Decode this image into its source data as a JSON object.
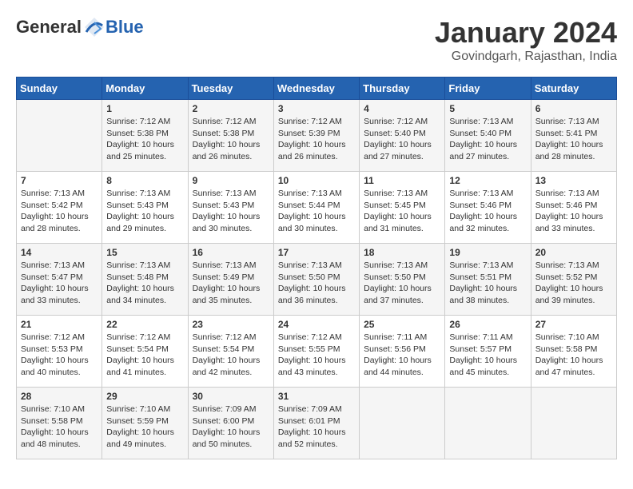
{
  "logo": {
    "general": "General",
    "blue": "Blue"
  },
  "title": "January 2024",
  "subtitle": "Govindgarh, Rajasthan, India",
  "days_of_week": [
    "Sunday",
    "Monday",
    "Tuesday",
    "Wednesday",
    "Thursday",
    "Friday",
    "Saturday"
  ],
  "weeks": [
    [
      {
        "day": "",
        "content": ""
      },
      {
        "day": "1",
        "content": "Sunrise: 7:12 AM\nSunset: 5:38 PM\nDaylight: 10 hours\nand 25 minutes."
      },
      {
        "day": "2",
        "content": "Sunrise: 7:12 AM\nSunset: 5:38 PM\nDaylight: 10 hours\nand 26 minutes."
      },
      {
        "day": "3",
        "content": "Sunrise: 7:12 AM\nSunset: 5:39 PM\nDaylight: 10 hours\nand 26 minutes."
      },
      {
        "day": "4",
        "content": "Sunrise: 7:12 AM\nSunset: 5:40 PM\nDaylight: 10 hours\nand 27 minutes."
      },
      {
        "day": "5",
        "content": "Sunrise: 7:13 AM\nSunset: 5:40 PM\nDaylight: 10 hours\nand 27 minutes."
      },
      {
        "day": "6",
        "content": "Sunrise: 7:13 AM\nSunset: 5:41 PM\nDaylight: 10 hours\nand 28 minutes."
      }
    ],
    [
      {
        "day": "7",
        "content": "Sunrise: 7:13 AM\nSunset: 5:42 PM\nDaylight: 10 hours\nand 28 minutes."
      },
      {
        "day": "8",
        "content": "Sunrise: 7:13 AM\nSunset: 5:43 PM\nDaylight: 10 hours\nand 29 minutes."
      },
      {
        "day": "9",
        "content": "Sunrise: 7:13 AM\nSunset: 5:43 PM\nDaylight: 10 hours\nand 30 minutes."
      },
      {
        "day": "10",
        "content": "Sunrise: 7:13 AM\nSunset: 5:44 PM\nDaylight: 10 hours\nand 30 minutes."
      },
      {
        "day": "11",
        "content": "Sunrise: 7:13 AM\nSunset: 5:45 PM\nDaylight: 10 hours\nand 31 minutes."
      },
      {
        "day": "12",
        "content": "Sunrise: 7:13 AM\nSunset: 5:46 PM\nDaylight: 10 hours\nand 32 minutes."
      },
      {
        "day": "13",
        "content": "Sunrise: 7:13 AM\nSunset: 5:46 PM\nDaylight: 10 hours\nand 33 minutes."
      }
    ],
    [
      {
        "day": "14",
        "content": "Sunrise: 7:13 AM\nSunset: 5:47 PM\nDaylight: 10 hours\nand 33 minutes."
      },
      {
        "day": "15",
        "content": "Sunrise: 7:13 AM\nSunset: 5:48 PM\nDaylight: 10 hours\nand 34 minutes."
      },
      {
        "day": "16",
        "content": "Sunrise: 7:13 AM\nSunset: 5:49 PM\nDaylight: 10 hours\nand 35 minutes."
      },
      {
        "day": "17",
        "content": "Sunrise: 7:13 AM\nSunset: 5:50 PM\nDaylight: 10 hours\nand 36 minutes."
      },
      {
        "day": "18",
        "content": "Sunrise: 7:13 AM\nSunset: 5:50 PM\nDaylight: 10 hours\nand 37 minutes."
      },
      {
        "day": "19",
        "content": "Sunrise: 7:13 AM\nSunset: 5:51 PM\nDaylight: 10 hours\nand 38 minutes."
      },
      {
        "day": "20",
        "content": "Sunrise: 7:13 AM\nSunset: 5:52 PM\nDaylight: 10 hours\nand 39 minutes."
      }
    ],
    [
      {
        "day": "21",
        "content": "Sunrise: 7:12 AM\nSunset: 5:53 PM\nDaylight: 10 hours\nand 40 minutes."
      },
      {
        "day": "22",
        "content": "Sunrise: 7:12 AM\nSunset: 5:54 PM\nDaylight: 10 hours\nand 41 minutes."
      },
      {
        "day": "23",
        "content": "Sunrise: 7:12 AM\nSunset: 5:54 PM\nDaylight: 10 hours\nand 42 minutes."
      },
      {
        "day": "24",
        "content": "Sunrise: 7:12 AM\nSunset: 5:55 PM\nDaylight: 10 hours\nand 43 minutes."
      },
      {
        "day": "25",
        "content": "Sunrise: 7:11 AM\nSunset: 5:56 PM\nDaylight: 10 hours\nand 44 minutes."
      },
      {
        "day": "26",
        "content": "Sunrise: 7:11 AM\nSunset: 5:57 PM\nDaylight: 10 hours\nand 45 minutes."
      },
      {
        "day": "27",
        "content": "Sunrise: 7:10 AM\nSunset: 5:58 PM\nDaylight: 10 hours\nand 47 minutes."
      }
    ],
    [
      {
        "day": "28",
        "content": "Sunrise: 7:10 AM\nSunset: 5:58 PM\nDaylight: 10 hours\nand 48 minutes."
      },
      {
        "day": "29",
        "content": "Sunrise: 7:10 AM\nSunset: 5:59 PM\nDaylight: 10 hours\nand 49 minutes."
      },
      {
        "day": "30",
        "content": "Sunrise: 7:09 AM\nSunset: 6:00 PM\nDaylight: 10 hours\nand 50 minutes."
      },
      {
        "day": "31",
        "content": "Sunrise: 7:09 AM\nSunset: 6:01 PM\nDaylight: 10 hours\nand 52 minutes."
      },
      {
        "day": "",
        "content": ""
      },
      {
        "day": "",
        "content": ""
      },
      {
        "day": "",
        "content": ""
      }
    ]
  ]
}
